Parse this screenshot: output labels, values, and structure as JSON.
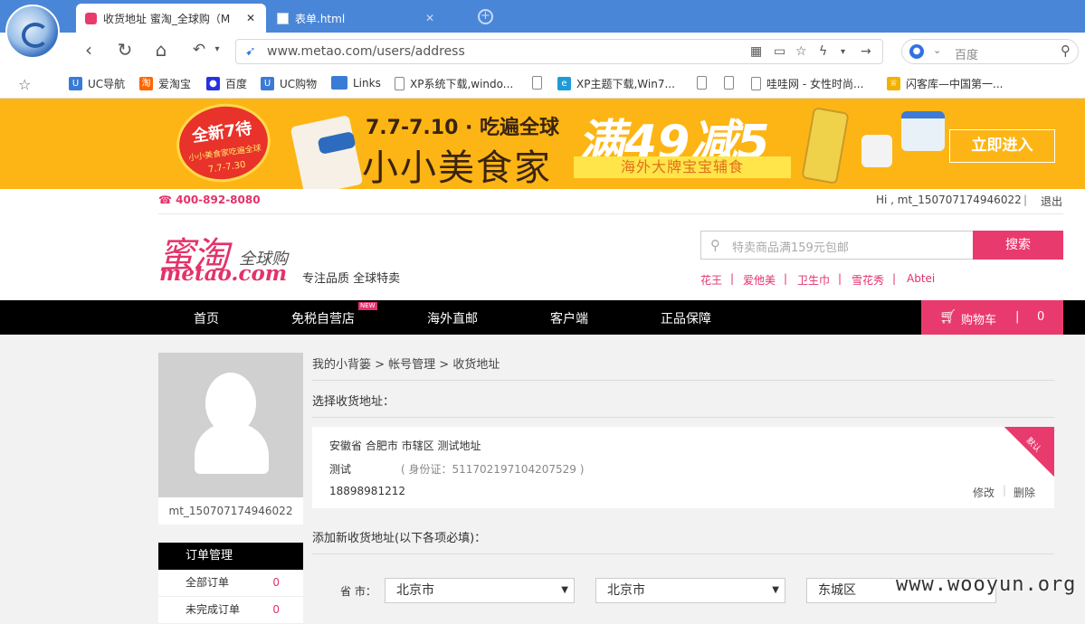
{
  "browser": {
    "tabs": [
      {
        "label": "收货地址 蜜淘_全球购（M",
        "close": "✕"
      },
      {
        "label": "表单.html",
        "close": "✕"
      }
    ],
    "new_tab": "+",
    "url": "www.metao.com/users/address",
    "search_placeholder": "百度",
    "bookmarks": [
      {
        "label": "UC导航"
      },
      {
        "label": "爱淘宝"
      },
      {
        "label": "百度"
      },
      {
        "label": "UC购物"
      },
      {
        "label": "Links"
      },
      {
        "label": "XP系统下载,windo..."
      },
      {
        "label": "XP主题下载,Win7..."
      },
      {
        "label": "哇哇网 - 女性时尚..."
      },
      {
        "label": "闪客库—中国第一..."
      }
    ]
  },
  "banner": {
    "badge_title": "全新7待",
    "badge_sub": "小小美食家吃遍全球",
    "badge_date": "7.7-7.30",
    "date": "7.7-7.10 · 吃遍全球",
    "name": "小小美食家",
    "deal": "满49减5",
    "sub": "海外大牌宝宝辅食",
    "enter": "立即进入"
  },
  "header": {
    "phone": "☎ 400-892-8080",
    "greeting": "Hi , mt_150707174946022",
    "separator": "|",
    "logout": "退出",
    "logo_cn": "蜜淘",
    "logo_global": "全球购",
    "logo_en": "metao.com",
    "slogan": "专注品质 全球特卖",
    "search_placeholder": "特卖商品满159元包邮",
    "search_button": "搜索",
    "hot_words": [
      "花王",
      "爱他美",
      "卫生巾",
      "雪花秀",
      "Abtei"
    ]
  },
  "nav": {
    "items": [
      "首页",
      "免税自营店",
      "海外直邮",
      "客户端",
      "正品保障"
    ],
    "new_tag": "NEW",
    "cart_label": "购物车",
    "cart_sep": "|",
    "cart_count": "0"
  },
  "sidebar": {
    "username": "mt_150707174946022",
    "order_header": "订单管理",
    "rows": [
      {
        "label": "全部订单",
        "count": "0"
      },
      {
        "label": "未完成订单",
        "count": "0"
      }
    ]
  },
  "main": {
    "breadcrumb": "我的小背篓 > 帐号管理 > 收货地址",
    "select_title": "选择收货地址：",
    "address": {
      "text": "安徽省 合肥市 市辖区 测试地址",
      "name": "测试",
      "id_card": "( 身份证：511702197104207529 )",
      "phone": "18898981212",
      "edit": "修改",
      "sep": "|",
      "delete": "删除",
      "default_tag": "默认"
    },
    "add_title": "添加新收货地址(以下各项必填)：",
    "province_label": "省 市：",
    "province": "北京市",
    "city": "北京市",
    "district": "东城区"
  },
  "watermark": "www.wooyun.org"
}
